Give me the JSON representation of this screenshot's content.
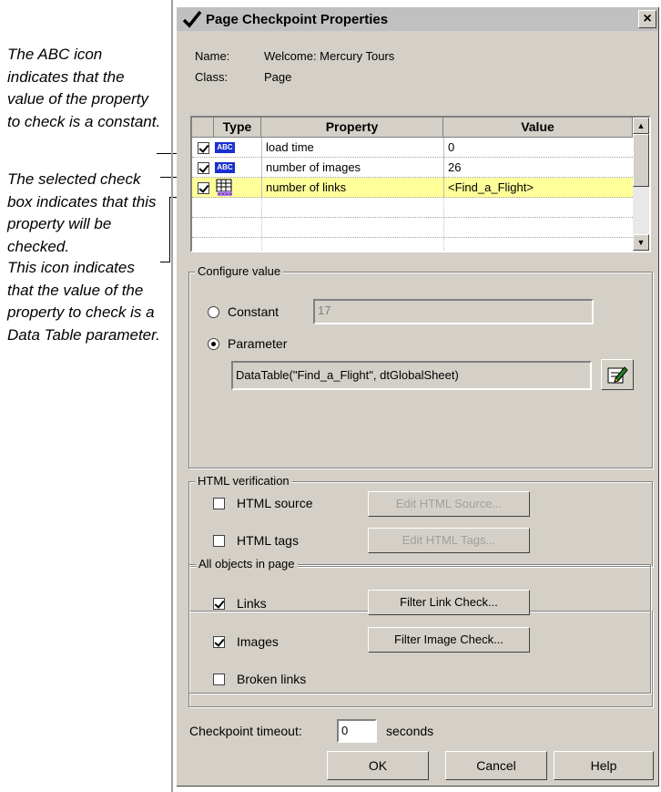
{
  "annotations": {
    "abc_icon": "The ABC icon indicates that the value of the property to check is a constant.",
    "selected_check": "The selected check box indicates that this property will be checked.",
    "data_icon": "This icon indicates that the value of the property to check is a Data Table parameter."
  },
  "dialog": {
    "title": "Page Checkpoint Properties",
    "close_glyph": "×",
    "name_label": "Name:",
    "name_value": "Welcome: Mercury Tours",
    "class_label": "Class:",
    "class_value": "Page"
  },
  "grid": {
    "headers": {
      "type": "Type",
      "property": "Property",
      "value": "Value"
    },
    "rows": [
      {
        "checked": true,
        "icon": "abc-icon",
        "property": "load time",
        "value": "0"
      },
      {
        "checked": true,
        "icon": "abc-icon",
        "property": "number of images",
        "value": "26"
      },
      {
        "checked": true,
        "icon": "data-table-icon",
        "property": "number of links",
        "value": "<Find_a_Flight>"
      }
    ]
  },
  "configure": {
    "title": "Configure value",
    "constant_label": "Constant",
    "constant_value": "17",
    "parameter_label": "Parameter",
    "parameter_value": "DataTable(\"Find_a_Flight\", dtGlobalSheet)",
    "selected": "parameter"
  },
  "html_verification": {
    "title": "HTML verification",
    "source_label": "HTML source",
    "source_button": "Edit HTML Source...",
    "tags_label": "HTML tags",
    "tags_button": "Edit HTML Tags..."
  },
  "all_objects": {
    "title": "All objects in page",
    "links_label": "Links",
    "links_button": "Filter Link Check...",
    "images_label": "Images",
    "images_button": "Filter Image Check...",
    "broken_label": "Broken links"
  },
  "timeout": {
    "label": "Checkpoint timeout:",
    "value": "0",
    "unit": "seconds"
  },
  "buttons": {
    "ok": "OK",
    "cancel": "Cancel",
    "help": "Help"
  }
}
